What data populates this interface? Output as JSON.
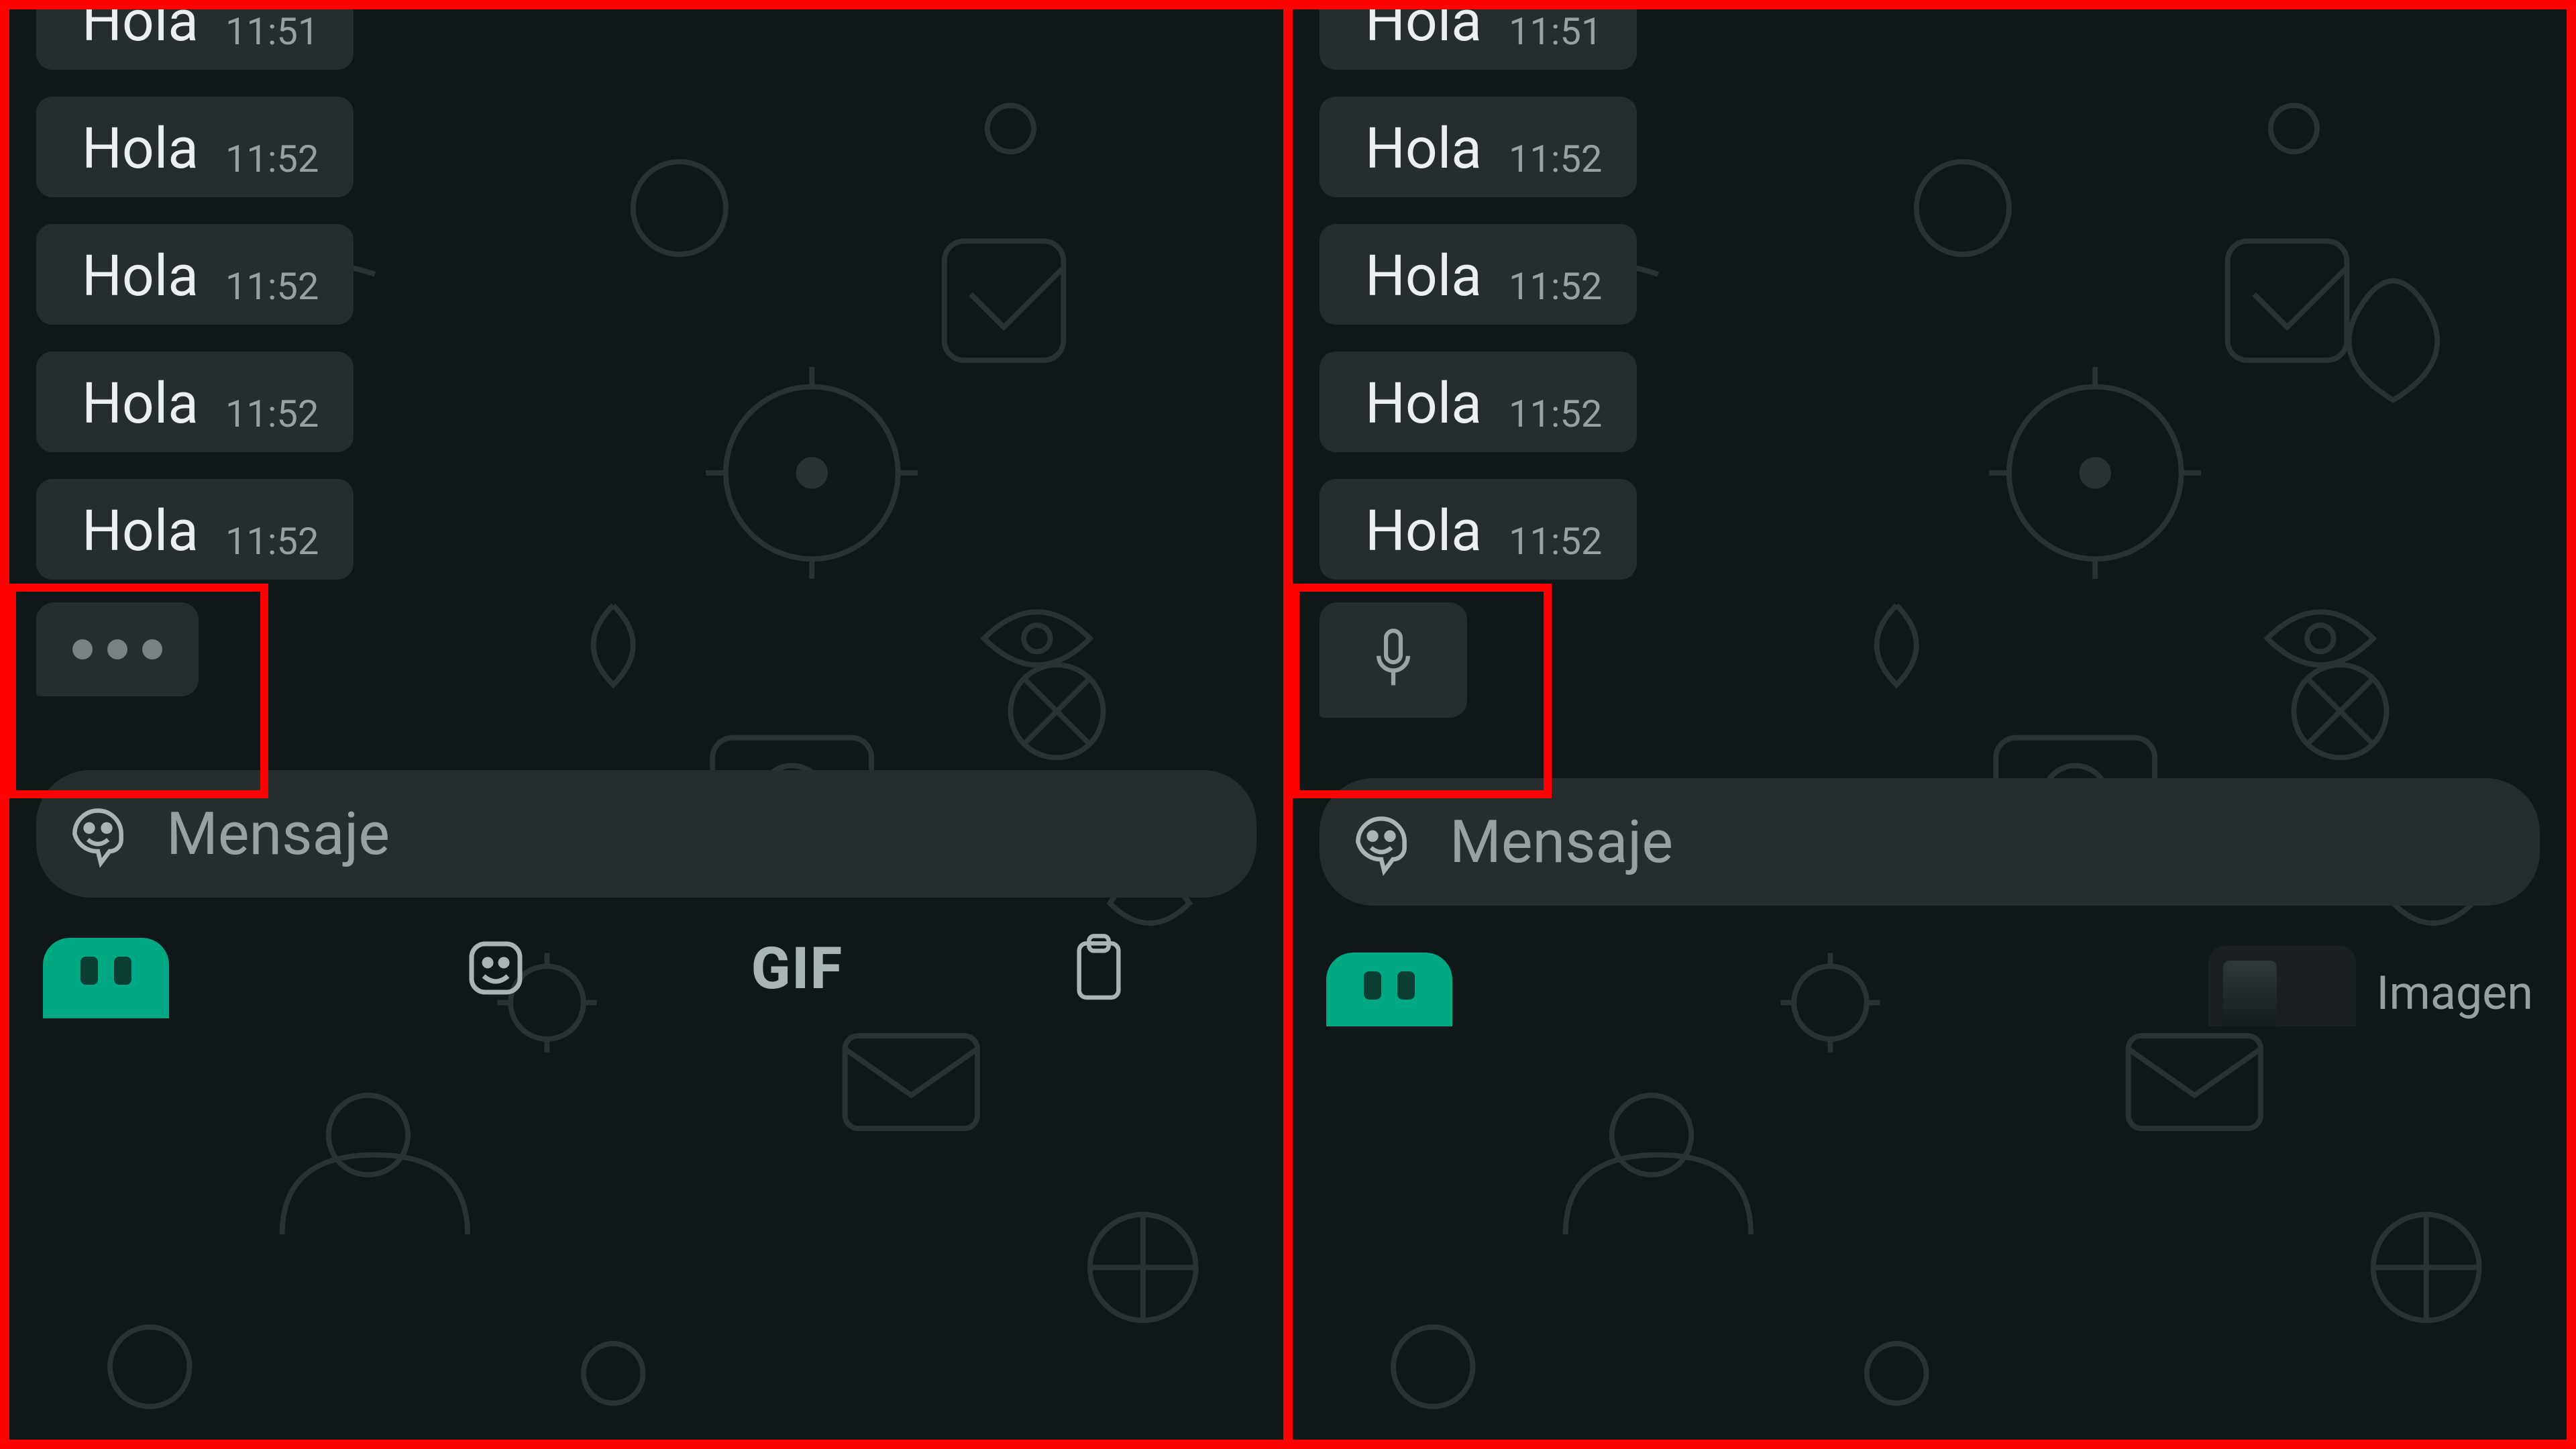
{
  "colors": {
    "accent": "#ff0000",
    "teal": "#00a884"
  },
  "left": {
    "messages": [
      {
        "text": "Hola",
        "time": "11:51"
      },
      {
        "text": "Hola",
        "time": "11:52"
      },
      {
        "text": "Hola",
        "time": "11:52"
      },
      {
        "text": "Hola",
        "time": "11:52"
      },
      {
        "text": "Hola",
        "time": "11:52"
      }
    ],
    "indicator": {
      "kind": "typing"
    },
    "input": {
      "placeholder": "Mensaje"
    },
    "keyboard": {
      "gif_label": "GIF"
    }
  },
  "right": {
    "messages": [
      {
        "text": "Hola",
        "time": "11:51"
      },
      {
        "text": "Hola",
        "time": "11:52"
      },
      {
        "text": "Hola",
        "time": "11:52"
      },
      {
        "text": "Hola",
        "time": "11:52"
      },
      {
        "text": "Hola",
        "time": "11:52"
      }
    ],
    "indicator": {
      "kind": "voice"
    },
    "input": {
      "placeholder": "Mensaje"
    },
    "keyboard": {
      "caption": "Imagen"
    }
  }
}
